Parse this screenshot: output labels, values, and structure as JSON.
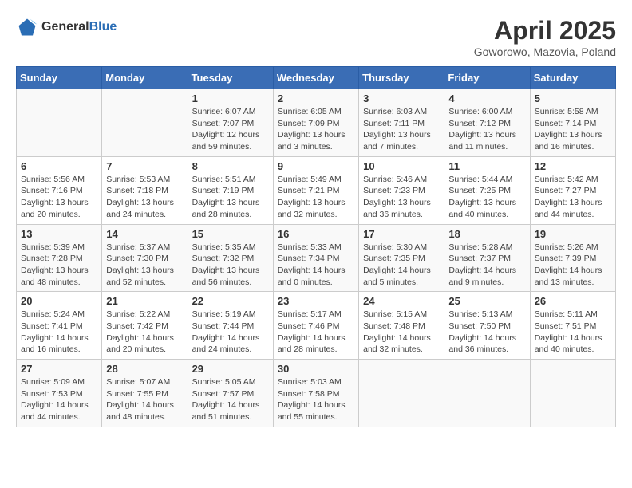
{
  "header": {
    "logo_general": "General",
    "logo_blue": "Blue",
    "title": "April 2025",
    "subtitle": "Goworowo, Mazovia, Poland"
  },
  "weekdays": [
    "Sunday",
    "Monday",
    "Tuesday",
    "Wednesday",
    "Thursday",
    "Friday",
    "Saturday"
  ],
  "weeks": [
    [
      {
        "day": "",
        "info": ""
      },
      {
        "day": "",
        "info": ""
      },
      {
        "day": "1",
        "info": "Sunrise: 6:07 AM\nSunset: 7:07 PM\nDaylight: 12 hours\nand 59 minutes."
      },
      {
        "day": "2",
        "info": "Sunrise: 6:05 AM\nSunset: 7:09 PM\nDaylight: 13 hours\nand 3 minutes."
      },
      {
        "day": "3",
        "info": "Sunrise: 6:03 AM\nSunset: 7:11 PM\nDaylight: 13 hours\nand 7 minutes."
      },
      {
        "day": "4",
        "info": "Sunrise: 6:00 AM\nSunset: 7:12 PM\nDaylight: 13 hours\nand 11 minutes."
      },
      {
        "day": "5",
        "info": "Sunrise: 5:58 AM\nSunset: 7:14 PM\nDaylight: 13 hours\nand 16 minutes."
      }
    ],
    [
      {
        "day": "6",
        "info": "Sunrise: 5:56 AM\nSunset: 7:16 PM\nDaylight: 13 hours\nand 20 minutes."
      },
      {
        "day": "7",
        "info": "Sunrise: 5:53 AM\nSunset: 7:18 PM\nDaylight: 13 hours\nand 24 minutes."
      },
      {
        "day": "8",
        "info": "Sunrise: 5:51 AM\nSunset: 7:19 PM\nDaylight: 13 hours\nand 28 minutes."
      },
      {
        "day": "9",
        "info": "Sunrise: 5:49 AM\nSunset: 7:21 PM\nDaylight: 13 hours\nand 32 minutes."
      },
      {
        "day": "10",
        "info": "Sunrise: 5:46 AM\nSunset: 7:23 PM\nDaylight: 13 hours\nand 36 minutes."
      },
      {
        "day": "11",
        "info": "Sunrise: 5:44 AM\nSunset: 7:25 PM\nDaylight: 13 hours\nand 40 minutes."
      },
      {
        "day": "12",
        "info": "Sunrise: 5:42 AM\nSunset: 7:27 PM\nDaylight: 13 hours\nand 44 minutes."
      }
    ],
    [
      {
        "day": "13",
        "info": "Sunrise: 5:39 AM\nSunset: 7:28 PM\nDaylight: 13 hours\nand 48 minutes."
      },
      {
        "day": "14",
        "info": "Sunrise: 5:37 AM\nSunset: 7:30 PM\nDaylight: 13 hours\nand 52 minutes."
      },
      {
        "day": "15",
        "info": "Sunrise: 5:35 AM\nSunset: 7:32 PM\nDaylight: 13 hours\nand 56 minutes."
      },
      {
        "day": "16",
        "info": "Sunrise: 5:33 AM\nSunset: 7:34 PM\nDaylight: 14 hours\nand 0 minutes."
      },
      {
        "day": "17",
        "info": "Sunrise: 5:30 AM\nSunset: 7:35 PM\nDaylight: 14 hours\nand 5 minutes."
      },
      {
        "day": "18",
        "info": "Sunrise: 5:28 AM\nSunset: 7:37 PM\nDaylight: 14 hours\nand 9 minutes."
      },
      {
        "day": "19",
        "info": "Sunrise: 5:26 AM\nSunset: 7:39 PM\nDaylight: 14 hours\nand 13 minutes."
      }
    ],
    [
      {
        "day": "20",
        "info": "Sunrise: 5:24 AM\nSunset: 7:41 PM\nDaylight: 14 hours\nand 16 minutes."
      },
      {
        "day": "21",
        "info": "Sunrise: 5:22 AM\nSunset: 7:42 PM\nDaylight: 14 hours\nand 20 minutes."
      },
      {
        "day": "22",
        "info": "Sunrise: 5:19 AM\nSunset: 7:44 PM\nDaylight: 14 hours\nand 24 minutes."
      },
      {
        "day": "23",
        "info": "Sunrise: 5:17 AM\nSunset: 7:46 PM\nDaylight: 14 hours\nand 28 minutes."
      },
      {
        "day": "24",
        "info": "Sunrise: 5:15 AM\nSunset: 7:48 PM\nDaylight: 14 hours\nand 32 minutes."
      },
      {
        "day": "25",
        "info": "Sunrise: 5:13 AM\nSunset: 7:50 PM\nDaylight: 14 hours\nand 36 minutes."
      },
      {
        "day": "26",
        "info": "Sunrise: 5:11 AM\nSunset: 7:51 PM\nDaylight: 14 hours\nand 40 minutes."
      }
    ],
    [
      {
        "day": "27",
        "info": "Sunrise: 5:09 AM\nSunset: 7:53 PM\nDaylight: 14 hours\nand 44 minutes."
      },
      {
        "day": "28",
        "info": "Sunrise: 5:07 AM\nSunset: 7:55 PM\nDaylight: 14 hours\nand 48 minutes."
      },
      {
        "day": "29",
        "info": "Sunrise: 5:05 AM\nSunset: 7:57 PM\nDaylight: 14 hours\nand 51 minutes."
      },
      {
        "day": "30",
        "info": "Sunrise: 5:03 AM\nSunset: 7:58 PM\nDaylight: 14 hours\nand 55 minutes."
      },
      {
        "day": "",
        "info": ""
      },
      {
        "day": "",
        "info": ""
      },
      {
        "day": "",
        "info": ""
      }
    ]
  ]
}
